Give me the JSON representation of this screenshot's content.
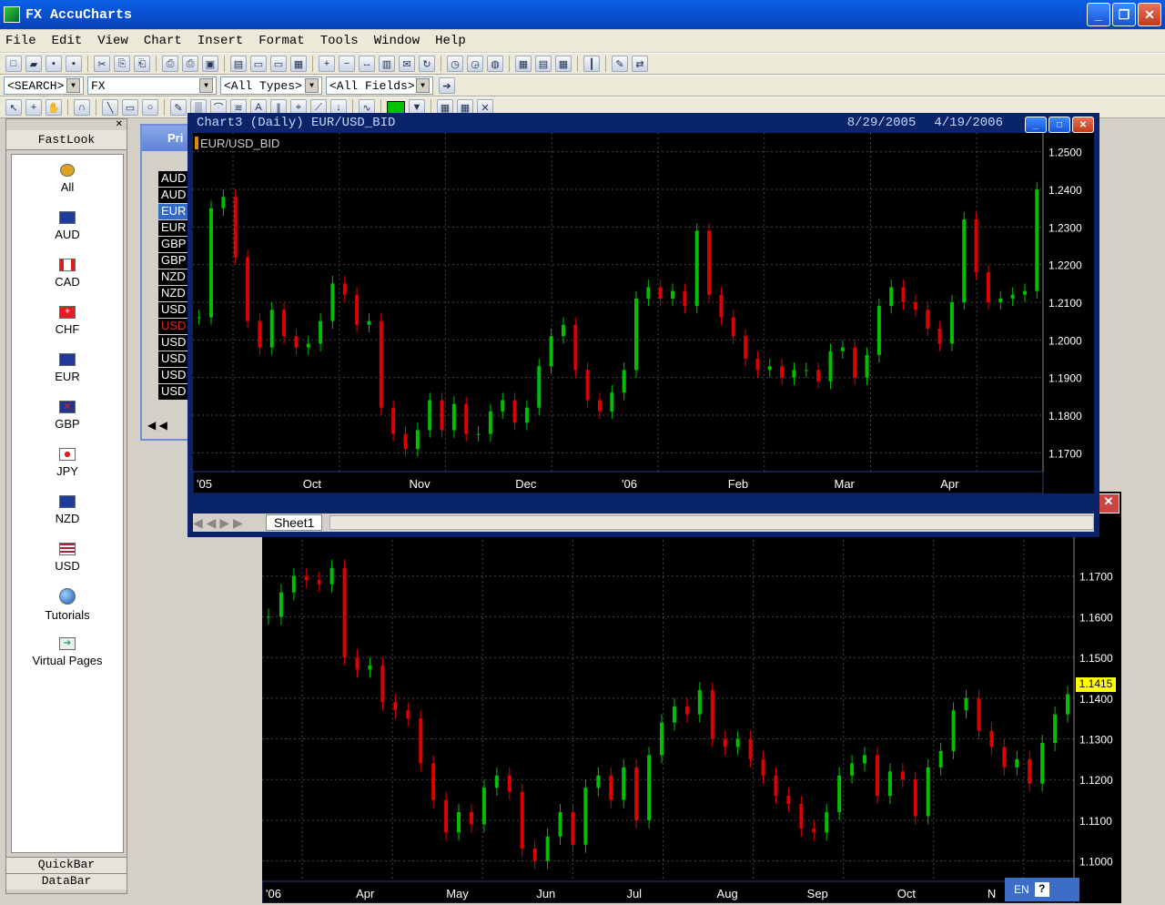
{
  "app": {
    "title": "FX AccuCharts"
  },
  "menu": [
    "File",
    "Edit",
    "View",
    "Chart",
    "Insert",
    "Format",
    "Tools",
    "Window",
    "Help"
  ],
  "filters": {
    "search": "<SEARCH>",
    "group": "FX",
    "types": "<All Types>",
    "fields": "<All Fields>"
  },
  "sidebar": {
    "header": "FastLook",
    "items": [
      {
        "label": "All",
        "icon": "coins-icon",
        "color": "#e0a020"
      },
      {
        "label": "AUD",
        "icon": "australia-flag-icon",
        "color": "#1d3d9c"
      },
      {
        "label": "CAD",
        "icon": "canada-flag-icon",
        "color": "#d42020"
      },
      {
        "label": "CHF",
        "icon": "swiss-flag-icon",
        "color": "#e02020"
      },
      {
        "label": "EUR",
        "icon": "eu-flag-icon",
        "color": "#203a9c"
      },
      {
        "label": "GBP",
        "icon": "uk-flag-icon",
        "color": "#22348c"
      },
      {
        "label": "JPY",
        "icon": "japan-flag-icon",
        "color": "#ffffff"
      },
      {
        "label": "NZD",
        "icon": "nz-flag-icon",
        "color": "#1d3d9c"
      },
      {
        "label": "USD",
        "icon": "us-flag-icon",
        "color": "#b22234"
      },
      {
        "label": "Tutorials",
        "icon": "globe-icon",
        "color": "#2a7ad0"
      },
      {
        "label": "Virtual Pages",
        "icon": "page-arrow-icon",
        "color": "#2a9a5a"
      }
    ],
    "footer": [
      "QuickBar",
      "DataBar"
    ]
  },
  "price_window": {
    "title": "Pri",
    "rows": [
      "AUD",
      "AUD",
      "EUR",
      "EUR",
      "GBP",
      "GBP",
      "NZD",
      "NZD",
      "USD",
      "USD",
      "USD",
      "USD",
      "USD",
      "USD"
    ]
  },
  "chart_top": {
    "title": "Chart3 (Daily) EUR/USD_BID",
    "range": "8/29/2005",
    "range_end": "4/19/2006",
    "legend": "EUR/USD_BID",
    "sheet": "Sheet1"
  },
  "chart_bottom": {
    "last_price": "1.1415"
  },
  "tray": {
    "lang": "EN"
  },
  "chart_data": [
    {
      "type": "candlestick",
      "series": [
        {
          "name": "EUR/USD_BID",
          "values": [
            1.206,
            1.235,
            1.238,
            1.222,
            1.205,
            1.198,
            1.208,
            1.201,
            1.198,
            1.199,
            1.205,
            1.215,
            1.212,
            1.204,
            1.205,
            1.182,
            1.175,
            1.171,
            1.176,
            1.184,
            1.176,
            1.183,
            1.175,
            1.175,
            1.181,
            1.184,
            1.178,
            1.182,
            1.193,
            1.201,
            1.204,
            1.192,
            1.184,
            1.181,
            1.186,
            1.192,
            1.211,
            1.214,
            1.211,
            1.213,
            1.209,
            1.229,
            1.212,
            1.206,
            1.201,
            1.195,
            1.192,
            1.193,
            1.19,
            1.192,
            1.192,
            1.189,
            1.197,
            1.198,
            1.19,
            1.196,
            1.209,
            1.214,
            1.21,
            1.208,
            1.203,
            1.199,
            1.21,
            1.232,
            1.218,
            1.21,
            1.211,
            1.212,
            1.213,
            1.24
          ]
        }
      ],
      "x_labels": [
        "'05",
        "Oct",
        "Nov",
        "Dec",
        "'06",
        "Feb",
        "Mar",
        "Apr"
      ],
      "y_ticks": [
        "1.2500",
        "1.2400",
        "1.2300",
        "1.2200",
        "1.2100",
        "1.2000",
        "1.1900",
        "1.1800",
        "1.1700"
      ],
      "ylim": [
        1.165,
        1.255
      ]
    },
    {
      "type": "candlestick",
      "series": [
        {
          "name": "",
          "values": [
            1.16,
            1.166,
            1.17,
            1.169,
            1.168,
            1.172,
            1.15,
            1.147,
            1.148,
            1.139,
            1.137,
            1.135,
            1.124,
            1.115,
            1.107,
            1.112,
            1.109,
            1.118,
            1.121,
            1.117,
            1.103,
            1.1,
            1.106,
            1.112,
            1.104,
            1.118,
            1.121,
            1.115,
            1.123,
            1.11,
            1.126,
            1.134,
            1.138,
            1.136,
            1.142,
            1.13,
            1.128,
            1.13,
            1.125,
            1.121,
            1.116,
            1.114,
            1.108,
            1.107,
            1.112,
            1.121,
            1.124,
            1.126,
            1.116,
            1.122,
            1.12,
            1.111,
            1.123,
            1.127,
            1.137,
            1.14,
            1.132,
            1.128,
            1.123,
            1.125,
            1.119,
            1.129,
            1.136,
            1.141
          ]
        }
      ],
      "x_labels": [
        "'06",
        "Apr",
        "May",
        "Jun",
        "Jul",
        "Aug",
        "Sep",
        "Oct",
        "N"
      ],
      "y_ticks": [
        "1.1700",
        "1.1600",
        "1.1500",
        "1.1400",
        "1.1300",
        "1.1200",
        "1.1100",
        "1.1000"
      ],
      "ylim": [
        1.095,
        1.18
      ]
    }
  ]
}
